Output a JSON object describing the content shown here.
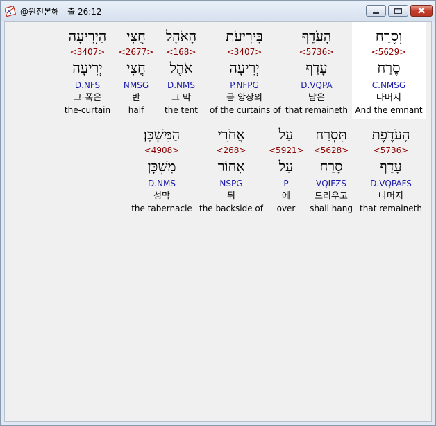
{
  "window": {
    "title": "@원전본해 - 출 26:12"
  },
  "rows": [
    {
      "words": [
        {
          "heb_form": "הַיְרִיעָה",
          "strong": "<3407>",
          "lemma": "יְרִיעָה",
          "morph": "D.NFS",
          "korean": "그-폭은",
          "english": "the-curtain"
        },
        {
          "heb_form": "חֲצִי",
          "strong": "<2677>",
          "lemma": "חֲצִי",
          "morph": "NMSG",
          "korean": "반",
          "english": "half"
        },
        {
          "heb_form": "הָאֹהֶל",
          "strong": "<168>",
          "lemma": "אֹהֶל",
          "morph": "D.NMS",
          "korean": "그 막",
          "english": "the tent"
        },
        {
          "heb_form": "בִּירִיעֹת",
          "strong": "<3407>",
          "lemma": "יְרִיעָה",
          "morph": "P.NFPG",
          "korean": "곧 앙장의",
          "english": "of the curtains of"
        },
        {
          "heb_form": "הָעֹדֵף",
          "strong": "<5736>",
          "lemma": "עָדַף",
          "morph": "D.VQPA",
          "korean": "남은",
          "english": "that remaineth"
        },
        {
          "heb_form": "וְסֶרַח",
          "strong": "<5629>",
          "lemma": "סֶרַח",
          "morph": "C.NMSG",
          "korean": "나머지",
          "english": "And the emnant"
        }
      ]
    },
    {
      "words": [
        {
          "heb_form": "הַמִּשְׁכָּן׃",
          "strong": "<4908>",
          "lemma": "מִשְׁכָּן",
          "morph": "D.NMS",
          "korean": "성막",
          "english": "the tabernacle"
        },
        {
          "heb_form": "אֲחֹרֵי",
          "strong": "<268>",
          "lemma": "אָחוֹר",
          "morph": "NSPG",
          "korean": "뒤",
          "english": "the backside of"
        },
        {
          "heb_form": "עַל",
          "strong": "<5921>",
          "lemma": "עַל",
          "morph": "P",
          "korean": "에",
          "english": "over"
        },
        {
          "heb_form": "תִּסְרַח",
          "strong": "<5628>",
          "lemma": "סָרַח",
          "morph": "VQIFZS",
          "korean": "드리우고",
          "english": "shall hang"
        },
        {
          "heb_form": "הָעֹדֶפֶת",
          "strong": "<5736>",
          "lemma": "עָדַף",
          "morph": "D.VQPAFS",
          "korean": "나머지",
          "english": "that remaineth"
        }
      ]
    }
  ]
}
